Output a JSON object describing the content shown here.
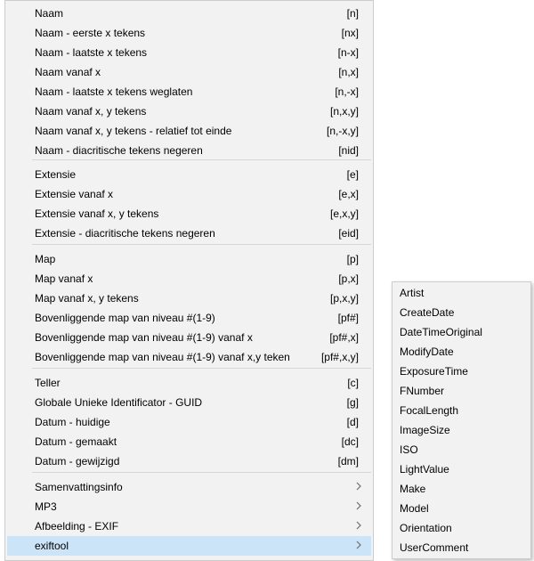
{
  "main_menu": {
    "groups": [
      [
        {
          "label": "Naam",
          "shortcut": "[n]"
        },
        {
          "label": "Naam - eerste x tekens",
          "shortcut": "[nx]"
        },
        {
          "label": "Naam - laatste x tekens",
          "shortcut": "[n-x]"
        },
        {
          "label": "Naam vanaf x",
          "shortcut": "[n,x]"
        },
        {
          "label": "Naam - laatste x tekens weglaten",
          "shortcut": "[n,-x]"
        },
        {
          "label": "Naam vanaf x, y tekens",
          "shortcut": "[n,x,y]"
        },
        {
          "label": "Naam vanaf x, y tekens - relatief tot einde",
          "shortcut": "[n,-x,y]"
        },
        {
          "label": "Naam - diacritische tekens negeren",
          "shortcut": "[nid]"
        }
      ],
      [
        {
          "label": "Extensie",
          "shortcut": "[e]"
        },
        {
          "label": "Extensie vanaf x",
          "shortcut": "[e,x]"
        },
        {
          "label": "Extensie vanaf x, y tekens",
          "shortcut": "[e,x,y]"
        },
        {
          "label": "Extensie - diacritische tekens negeren",
          "shortcut": "[eid]"
        }
      ],
      [
        {
          "label": "Map",
          "shortcut": "[p]"
        },
        {
          "label": "Map vanaf x",
          "shortcut": "[p,x]"
        },
        {
          "label": "Map vanaf x, y tekens",
          "shortcut": "[p,x,y]"
        },
        {
          "label": "Bovenliggende map van niveau #(1-9)",
          "shortcut": "[pf#]"
        },
        {
          "label": "Bovenliggende map van niveau #(1-9) vanaf x",
          "shortcut": "[pf#,x]"
        },
        {
          "label": "Bovenliggende map van niveau #(1-9) vanaf x,y teken",
          "shortcut": "[pf#,x,y]"
        }
      ],
      [
        {
          "label": "Teller",
          "shortcut": "[c]"
        },
        {
          "label": "Globale Unieke Identificator - GUID",
          "shortcut": "[g]"
        },
        {
          "label": "Datum - huidige",
          "shortcut": "[d]"
        },
        {
          "label": "Datum - gemaakt",
          "shortcut": "[dc]"
        },
        {
          "label": "Datum - gewijzigd",
          "shortcut": "[dm]"
        }
      ],
      [
        {
          "label": "Samenvattingsinfo",
          "submenu": true
        },
        {
          "label": "MP3",
          "submenu": true
        },
        {
          "label": "Afbeelding - EXIF",
          "submenu": true
        },
        {
          "label": "exiftool",
          "submenu": true,
          "highlighted": true
        }
      ]
    ]
  },
  "submenu": {
    "items": [
      "Artist",
      "CreateDate",
      "DateTimeOriginal",
      "ModifyDate",
      "ExposureTime",
      "FNumber",
      "FocalLength",
      "ImageSize",
      "ISO",
      "LightValue",
      "Make",
      "Model",
      "Orientation",
      "UserComment"
    ]
  },
  "colors": {
    "highlight": "#cce4f7",
    "menu_bg": "#f2f2f2",
    "separator": "#d7d7d7",
    "arrow": "#6d6d6d"
  },
  "icons": {
    "submenu_arrow": "chevron-right-icon"
  }
}
